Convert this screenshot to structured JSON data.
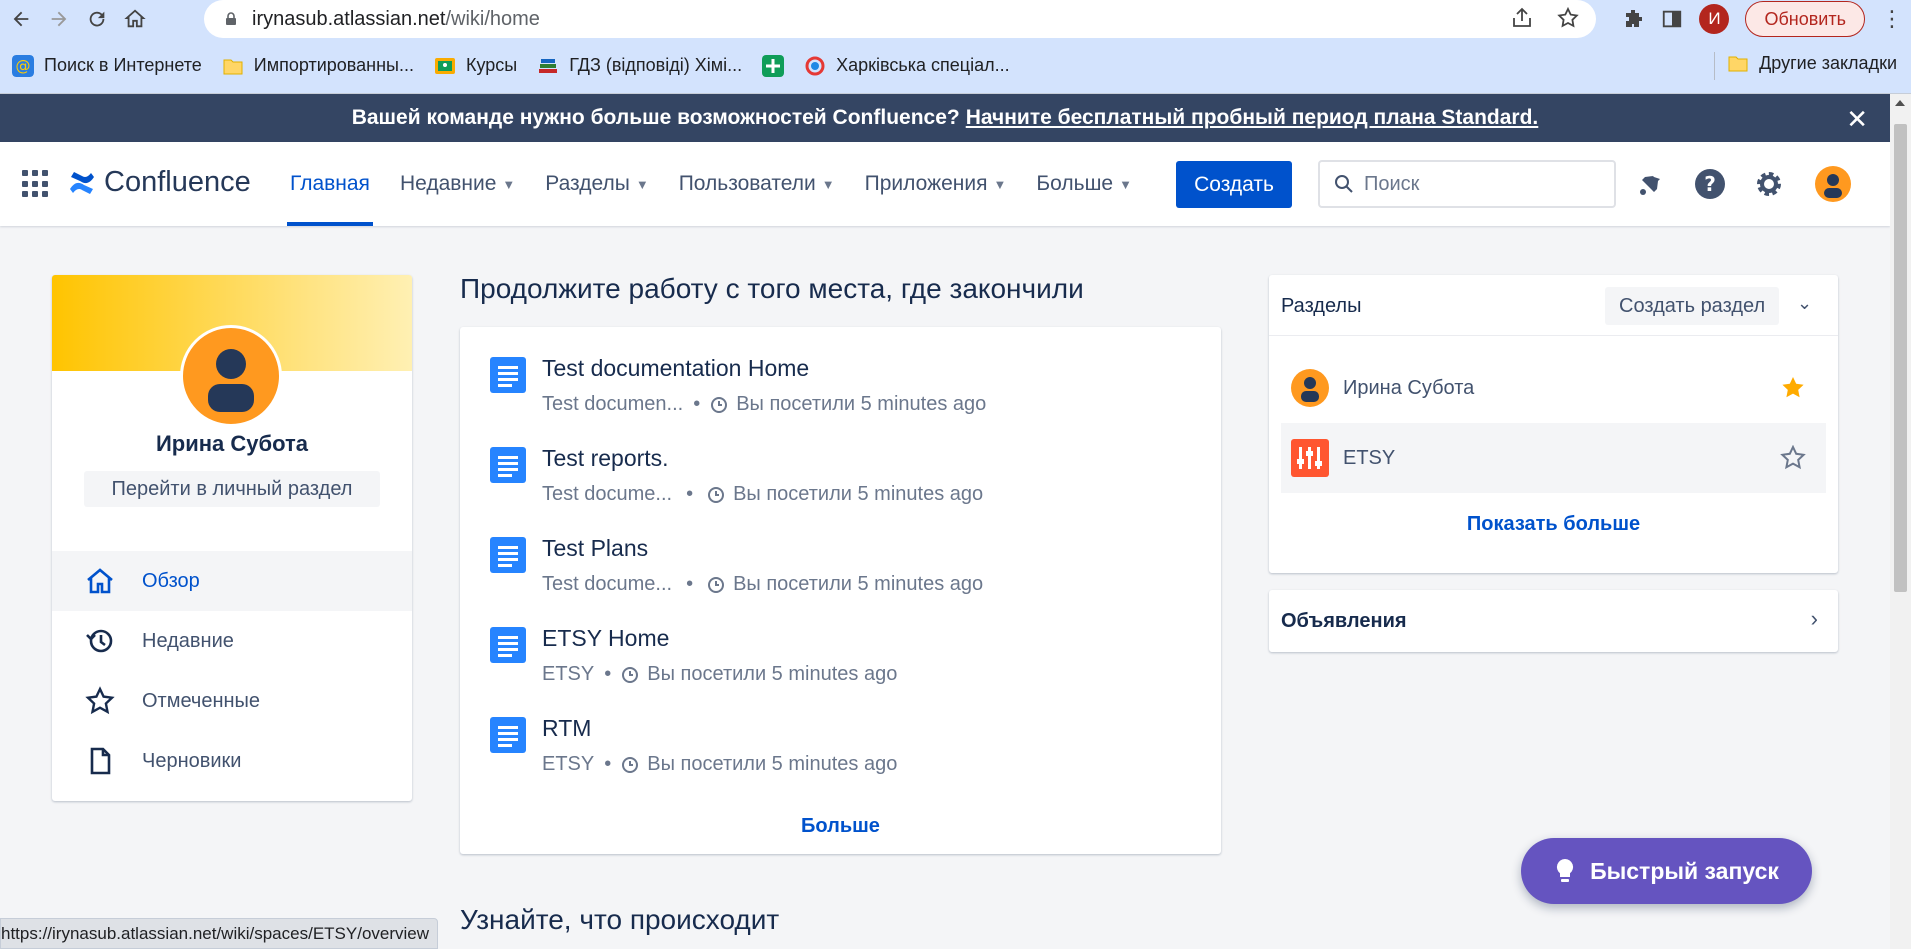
{
  "browser": {
    "url_host": "irynasub.atlassian.net",
    "url_path": "/wiki/home",
    "profile_initial": "И",
    "update_label": "Обновить",
    "bookmarks": [
      {
        "label": "Поиск в Интернете",
        "icon": "at-icon"
      },
      {
        "label": "Импортированны...",
        "icon": "folder-icon"
      },
      {
        "label": "Курсы",
        "icon": "classroom-icon"
      },
      {
        "label": "ГДЗ (відповіді) Хімі...",
        "icon": "books-icon"
      },
      {
        "label": "",
        "icon": "plus-icon"
      },
      {
        "label": "Харківська спеціал...",
        "icon": "sync-icon"
      }
    ],
    "other_bookmarks": "Другие закладки",
    "status_url": "https://irynasub.atlassian.net/wiki/spaces/ETSY/overview"
  },
  "banner": {
    "text": "Вашей команде нужно больше возможностей Confluence?",
    "link": "Начните бесплатный пробный период плана Standard."
  },
  "header": {
    "logo": "Confluence",
    "nav": [
      {
        "label": "Главная",
        "active": true
      },
      {
        "label": "Недавние",
        "dropdown": true
      },
      {
        "label": "Разделы",
        "dropdown": true
      },
      {
        "label": "Пользователи",
        "dropdown": true
      },
      {
        "label": "Приложения",
        "dropdown": true
      },
      {
        "label": "Больше",
        "dropdown": true
      }
    ],
    "create_label": "Создать",
    "search_placeholder": "Поиск"
  },
  "profile": {
    "name": "Ирина Субота",
    "personal_space_link": "Перейти в личный раздел",
    "menu": [
      {
        "label": "Обзор",
        "icon": "home-icon",
        "active": true
      },
      {
        "label": "Недавние",
        "icon": "history-icon"
      },
      {
        "label": "Отмеченные",
        "icon": "star-icon"
      },
      {
        "label": "Черновики",
        "icon": "page-icon"
      }
    ]
  },
  "continue": {
    "title": "Продолжите работу с того места, где закончили",
    "items": [
      {
        "title": "Test documentation Home",
        "space": "Test documen...",
        "visited": "Вы посетили 5 minutes ago"
      },
      {
        "title": "Test reports.",
        "space": "Test docume...",
        "visited": "Вы посетили 5 minutes ago"
      },
      {
        "title": "Test Plans",
        "space": "Test docume...",
        "visited": "Вы посетили 5 minutes ago"
      },
      {
        "title": "ETSY Home",
        "space": "ETSY",
        "visited": "Вы посетили 5 minutes ago"
      },
      {
        "title": "RTM",
        "space": "ETSY",
        "visited": "Вы посетили 5 minutes ago"
      }
    ],
    "more": "Больше"
  },
  "whats_happening": "Узнайте, что происходит",
  "spaces": {
    "title": "Разделы",
    "create": "Создать раздел",
    "items": [
      {
        "name": "Ирина Субота",
        "starred": true
      },
      {
        "name": "ETSY",
        "starred": false
      }
    ],
    "show_more": "Показать больше"
  },
  "announcements": "Объявления",
  "quick_start": "Быстрый запуск",
  "colors": {
    "primary": "#0052cc",
    "banner": "#344563",
    "quick": "#6554c0",
    "star": "#ffab00"
  }
}
